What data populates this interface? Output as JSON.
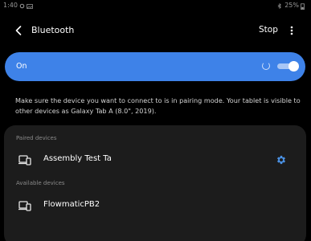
{
  "status_bar": {
    "time": "1:40",
    "battery": "25%"
  },
  "header": {
    "title": "Bluetooth",
    "stop_label": "Stop"
  },
  "bluetooth_toggle": {
    "label": "On",
    "enabled": true,
    "scanning": true,
    "accent_color": "#3e82e8"
  },
  "description": "Make sure the device you want to connect to is in pairing mode. Your tablet is visible to other devices as Galaxy Tab A (8.0\", 2019).",
  "paired": {
    "header": "Paired devices",
    "devices": [
      {
        "name": "Assembly Test Ta",
        "icon": "laptop-icon",
        "has_settings": true
      }
    ]
  },
  "available": {
    "header": "Available devices",
    "devices": [
      {
        "name": "FlowmaticPB2",
        "icon": "laptop-icon"
      }
    ]
  },
  "colors": {
    "background": "#000000",
    "card": "#1c1c1c",
    "settings_icon": "#4a90e2"
  }
}
